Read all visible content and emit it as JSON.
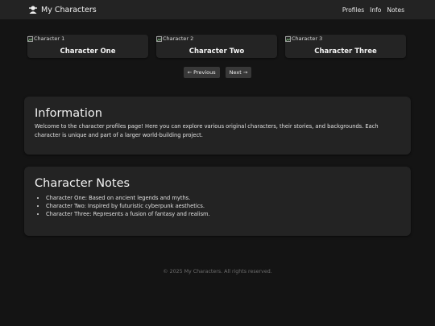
{
  "nav": {
    "brand": "My Characters",
    "links": [
      "Profiles",
      "Info",
      "Notes"
    ]
  },
  "cards": [
    {
      "alt": "Character 1",
      "title": "Character One"
    },
    {
      "alt": "Character 2",
      "title": "Character Two"
    },
    {
      "alt": "Character 3",
      "title": "Character Three"
    }
  ],
  "pager": {
    "prev": "Previous",
    "next": "Next"
  },
  "info": {
    "heading": "Information",
    "body": "Welcome to the character profiles page! Here you can explore various original characters, their stories, and backgrounds. Each character is unique and part of a larger world-building project."
  },
  "notes": {
    "heading": "Character Notes",
    "items": [
      "Character One: Based on ancient legends and myths.",
      "Character Two: Inspired by futuristic cyberpunk aesthetics.",
      "Character Three: Represents a fusion of fantasy and realism."
    ]
  },
  "footer": "© 2025 My Characters. All rights reserved.",
  "colors": {
    "background": "#141414",
    "navbar": "#232323",
    "panel": "#232323",
    "button": "#383838"
  }
}
